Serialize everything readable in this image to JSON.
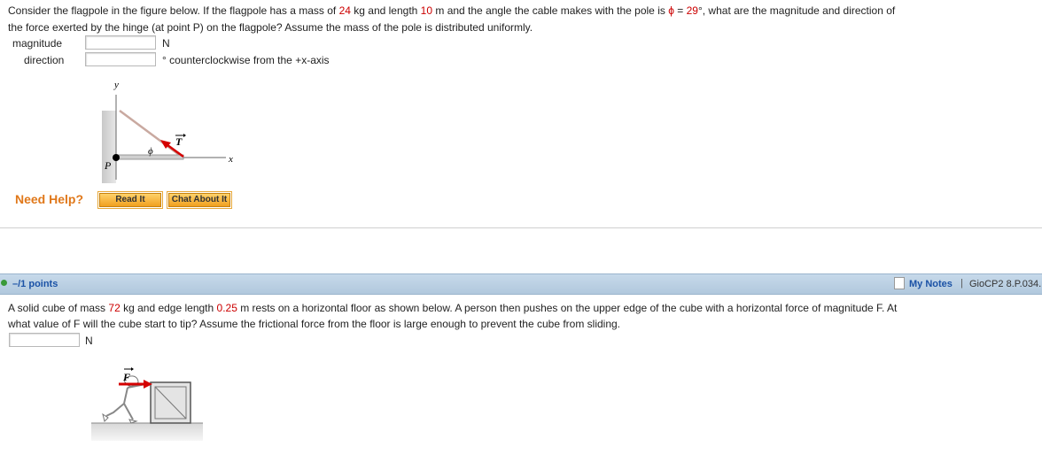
{
  "q1": {
    "text_a": "Consider the flagpole in the figure below. If the flagpole has a mass of ",
    "mass": "24",
    "text_b": " kg and length ",
    "length": "10",
    "text_c": " m and the angle the cable makes with the pole is ",
    "phi_symbol": "ϕ",
    "text_d": " = ",
    "angle": "29",
    "text_e": "°, what are the magnitude and direction of",
    "line2": "the force exerted by the hinge (at point P) on the flagpole? Assume the mass of the pole is distributed uniformly.",
    "magnitude_label": "magnitude",
    "magnitude_unit": "N",
    "magnitude_value": "",
    "direction_label": "direction",
    "direction_unit": "° counterclockwise from the +x-axis",
    "direction_value": "",
    "figure": {
      "y_label": "y",
      "x_label": "x",
      "p_label": "P",
      "phi_label": "ϕ",
      "t_label": "T"
    },
    "help": {
      "label": "Need Help?",
      "read_it": "Read It",
      "chat_about_it": "Chat About It"
    }
  },
  "q2_header": {
    "points": "–/1 points",
    "my_notes": "My Notes",
    "separator": "|",
    "problem_code": "GioCP2 8.P.034."
  },
  "q2": {
    "text_a": "A solid cube of mass ",
    "mass": "72",
    "text_b": " kg and edge length ",
    "edge": "0.25",
    "text_c": " m rests on a horizontal floor as shown below. A person then pushes on the upper edge of the cube with a horizontal force of magnitude F. At",
    "line2": "what value of F will the cube start to tip? Assume the frictional force from the floor is large enough to prevent the cube from sliding.",
    "answer_value": "",
    "answer_unit": "N",
    "figure": {
      "f_label": "F"
    }
  },
  "colors": {
    "highlight_red": "#cc0000",
    "help_orange": "#e0781a",
    "link_blue": "#1b52a6",
    "bar_blue": "#c2d6e8"
  }
}
